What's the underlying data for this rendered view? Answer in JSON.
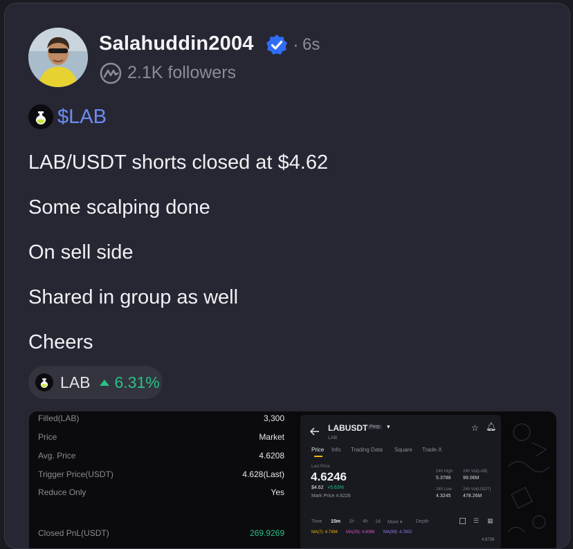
{
  "post": {
    "username": "Salahuddin2004",
    "separator": "·",
    "time_ago": "6s",
    "followers": "2.1K followers",
    "ticker": "$LAB",
    "lines": [
      "LAB/USDT shorts closed at $4.62",
      "Some scalping done",
      "On sell side",
      "Shared in group as well",
      "Cheers"
    ],
    "coin_pill": {
      "symbol": "LAB",
      "change": "6.31%",
      "change_color": "#27c287"
    }
  },
  "order_details": [
    {
      "label": "Filled(LAB)",
      "value": "3,300"
    },
    {
      "label": "Price",
      "value": "Market"
    },
    {
      "label": "Avg. Price",
      "value": "4.6208"
    },
    {
      "label": "Trigger Price(USDT)",
      "value": "4.628(Last)"
    },
    {
      "label": "Reduce Only",
      "value": "Yes"
    },
    {
      "label": "Closed PnL(USDT)",
      "value": "269.9269"
    }
  ],
  "trade_screen": {
    "pair": "LABUSDT",
    "perp_badge": "Perp",
    "sub": "LAB",
    "tabs": [
      "Price",
      "Info",
      "Trading Data",
      "Square",
      "Trade-X"
    ],
    "last_price_label": "Last Price",
    "last_price": "4.6246",
    "usd_price": "$4.62",
    "change": "+5.63%",
    "mark_price": "Mark Price 4.6226",
    "stats": [
      {
        "label": "24h High",
        "value": "5.3788"
      },
      {
        "label": "24h Vol(LAB)",
        "value": "99.06M"
      },
      {
        "label": "24h Low",
        "value": "4.3245"
      },
      {
        "label": "24h Vol(USDT)",
        "value": "478.26M"
      }
    ],
    "timeframes": [
      "Time",
      "15m",
      "1h",
      "4h",
      "1d",
      "More ▾",
      "Depth"
    ],
    "ma": [
      "MA(7): 4.7494",
      "MA(25): 4.8069",
      "MA(99): 4.7802"
    ],
    "bottom_value": "4.8736"
  },
  "colors": {
    "accent_blue": "#6e8bf3",
    "verified_blue": "#2f6df6",
    "positive_green": "#27c287",
    "card_bg": "#272733"
  },
  "icons": [
    "verified-badge-icon",
    "coinmarketcap-icon",
    "lab-coin-icon",
    "arrow-up-icon",
    "back-arrow-icon",
    "star-icon",
    "bell-icon"
  ]
}
